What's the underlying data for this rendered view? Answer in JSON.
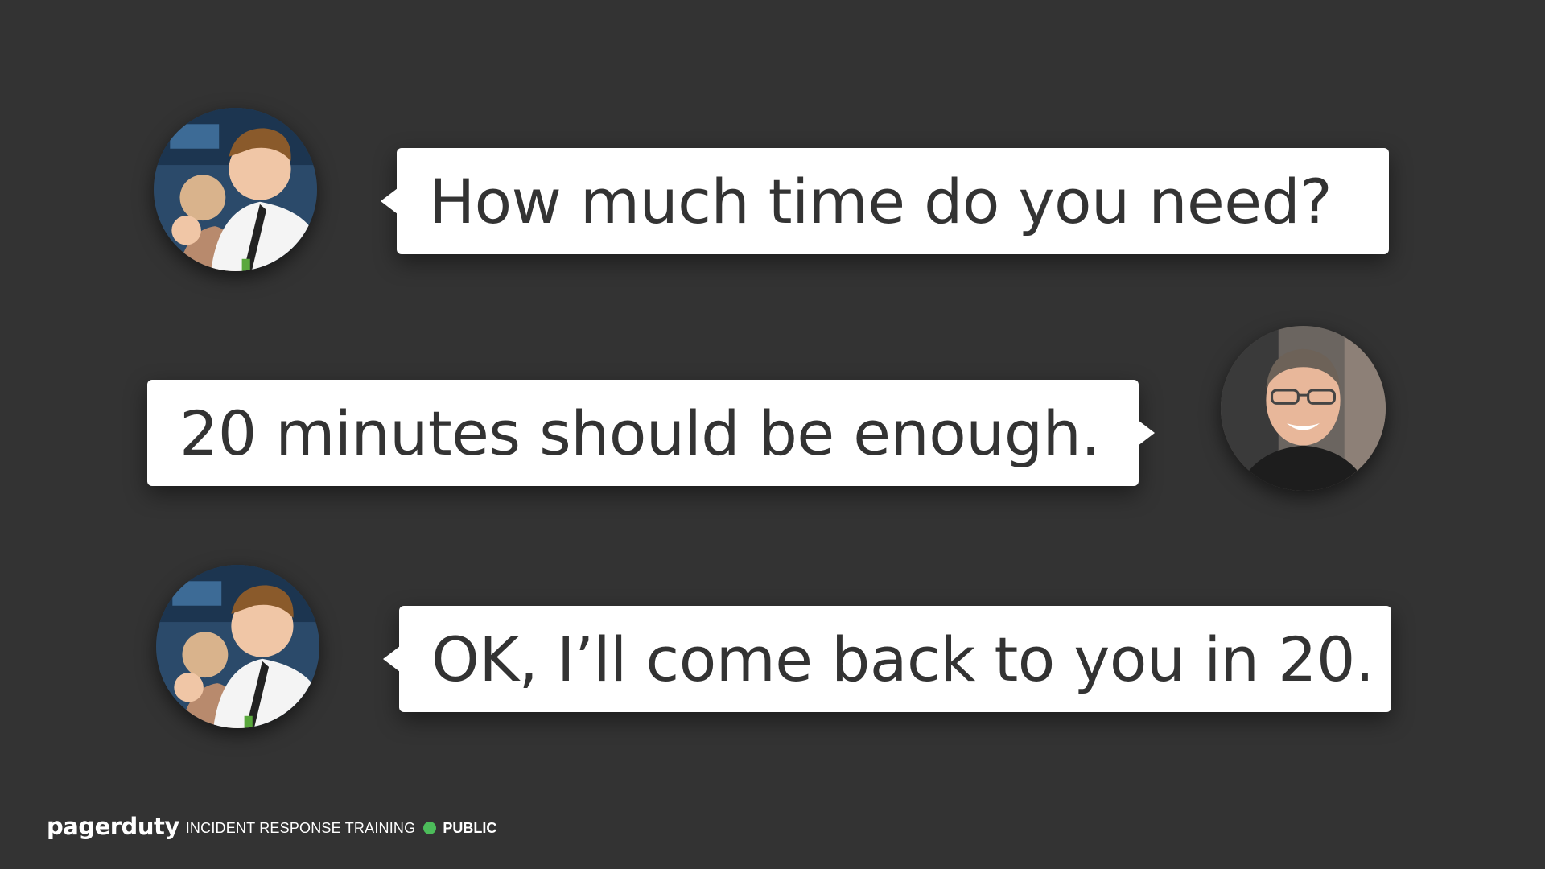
{
  "conversation": {
    "messages": [
      {
        "speaker": "person-1",
        "text": "How much time do you need?"
      },
      {
        "speaker": "person-2",
        "text": "20 minutes should be enough."
      },
      {
        "speaker": "person-1",
        "text": "OK, I’ll come back to you in 20."
      }
    ]
  },
  "footer": {
    "logo": "pagerduty",
    "label": "INCIDENT RESPONSE TRAINING",
    "classification": "PUBLIC"
  },
  "colors": {
    "background": "#333333",
    "bubble": "#ffffff",
    "text": "#333333",
    "status_dot": "#4cbc5a"
  }
}
